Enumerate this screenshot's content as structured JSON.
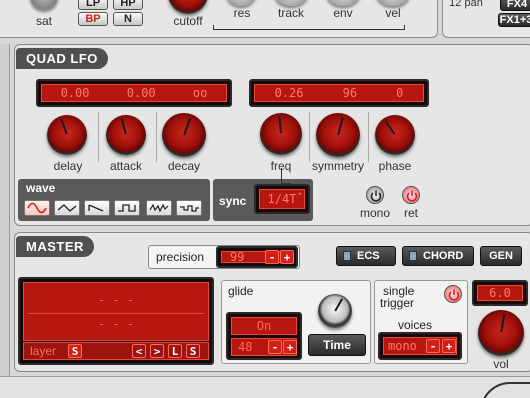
{
  "top": {
    "sat_label": "sat",
    "filter_buttons": [
      "LP",
      "HP",
      "BP",
      "N"
    ],
    "cutoff_label": "cutoff",
    "res_label": "res",
    "track_label": "track",
    "env_label": "env",
    "vel_label": "vel",
    "pan_label": "12 pan",
    "fx_buttons": [
      "FX4",
      "FX1+3"
    ]
  },
  "quad_lfo": {
    "title": "QUAD LFO",
    "display1": [
      "0.00",
      "0.00",
      "oo"
    ],
    "display2": [
      "0.26",
      "96",
      "0"
    ],
    "knobs": [
      "delay",
      "attack",
      "decay",
      "freq",
      "symmetry",
      "phase"
    ],
    "wave_label": "wave",
    "sync_label": "sync",
    "sync_value": "1/4T",
    "mono_label": "mono",
    "ret_label": "ret"
  },
  "master": {
    "title": "MASTER",
    "ecs_label": "ECS",
    "chord_label": "CHORD",
    "gen_label": "GEN",
    "precision_label": "precision",
    "precision_value": "99",
    "display_lines": [
      "- - -",
      "- - -"
    ],
    "layer_label": "layer",
    "layer_value": "S",
    "nav_buttons": [
      "<",
      ">",
      "L",
      "S"
    ],
    "glide_label": "glide",
    "glide_on": "On",
    "glide_value": "48",
    "time_label": "Time",
    "single_trigger_label_1": "single",
    "single_trigger_label_2": "trigger",
    "voices_label": "voices",
    "voices_value": "mono",
    "vol_value": "6.0",
    "vol_label": "vol"
  },
  "controls": {
    "minus": "-",
    "plus": "+"
  },
  "colors": {
    "accent": "#c8281c",
    "panel": "#e6e6e6",
    "lcd": "#b81610"
  }
}
